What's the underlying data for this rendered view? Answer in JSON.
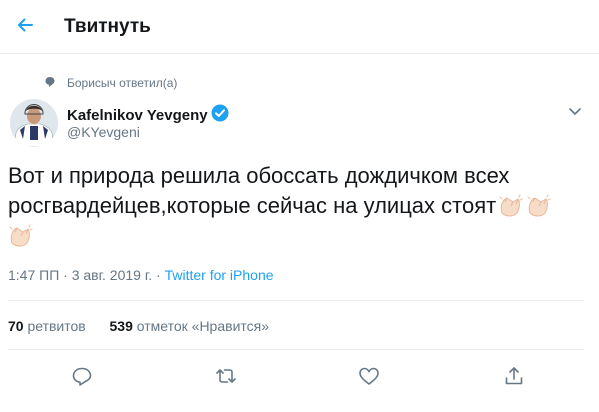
{
  "header": {
    "title": "Твитнуть",
    "back_icon": "back-arrow-icon"
  },
  "reply_context": {
    "text": "Борисыч ответил(а)",
    "icon": "reply-indicator-icon"
  },
  "author": {
    "name": "Kafelnikov Yevgeny",
    "handle": "@KYevgeni",
    "verified": true,
    "avatar": "avatar-photo"
  },
  "tweet": {
    "text_line1": "Вот и природа решила обоссать дождичком всех",
    "text_line2": "росгвардейцев,которые сейчас на улицах стоят",
    "emoji": "clapping-hands"
  },
  "meta": {
    "time": "1:47 ПП",
    "separator1": " · ",
    "date": "3 авг. 2019 г.",
    "separator2": " · ",
    "source": "Twitter for iPhone"
  },
  "stats": {
    "retweets_count": "70",
    "retweets_label": "ретвитов",
    "likes_count": "539",
    "likes_label": "отметок «Нравится»"
  },
  "actions": [
    "reply-icon",
    "retweet-icon",
    "like-icon",
    "share-icon"
  ],
  "colors": {
    "accent": "#1da1f2",
    "text": "#14171a",
    "muted": "#657786",
    "border": "#e6ecf0"
  }
}
